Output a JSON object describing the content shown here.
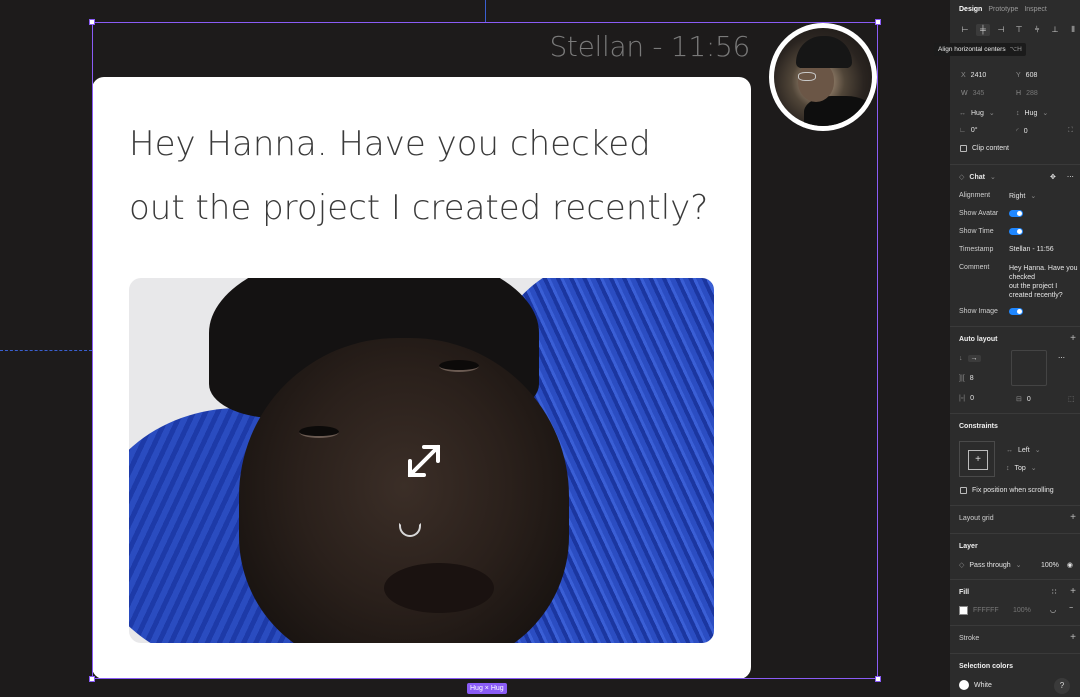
{
  "canvas": {
    "timestamp": "Stellan - 11:56",
    "message_line1": "Hey Hanna. Have you checked",
    "message_line2": "out the project I created recently?",
    "hug_badge": "Hug × Hug"
  },
  "panel": {
    "tabs": [
      "Design",
      "Prototype",
      "Inspect"
    ],
    "tooltip": {
      "label": "Align horizontal centers",
      "shortcut": "⌥H"
    },
    "frame": {
      "x_label": "X",
      "x_value": "2410",
      "y_label": "Y",
      "y_value": "608",
      "w_label": "W",
      "w_value": "345",
      "h_label": "H",
      "h_value": "288",
      "hug_w": "Hug",
      "hug_h": "Hug",
      "rotation": "0°",
      "radius": "0",
      "clip_content": "Clip content"
    },
    "component": {
      "name": "Chat",
      "props": [
        {
          "label": "Alignment",
          "value": "Right"
        },
        {
          "label": "Show Avatar",
          "value": "on"
        },
        {
          "label": "Show Time",
          "value": "on"
        },
        {
          "label": "Timestamp",
          "value": "Stellan - 11:56"
        },
        {
          "label": "Comment",
          "value": "Hey Hanna. Have you checked out the project I created recently?"
        },
        {
          "label": "Show Image",
          "value": "on"
        }
      ],
      "comment_lines": [
        "Hey Hanna. Have you",
        "checked",
        "out the project I",
        "created recently?"
      ]
    },
    "auto_layout": {
      "title": "Auto layout",
      "spacing": "8",
      "pad_h": "0",
      "pad_v": "0"
    },
    "constraints": {
      "title": "Constraints",
      "horizontal": "Left",
      "vertical": "Top",
      "fix_scroll": "Fix position when scrolling"
    },
    "layout_grid": "Layout grid",
    "layer": {
      "title": "Layer",
      "blend": "Pass through",
      "opacity": "100%"
    },
    "fill": {
      "title": "Fill",
      "hex": "FFFFFF",
      "opacity": "100%"
    },
    "stroke": "Stroke",
    "selection_colors": {
      "title": "Selection colors",
      "color_name": "White"
    },
    "help": "?"
  },
  "colors": {
    "selection": "#8a5cf6",
    "toggle": "#1f87ff",
    "knit_blue": "#2b4dc2"
  }
}
